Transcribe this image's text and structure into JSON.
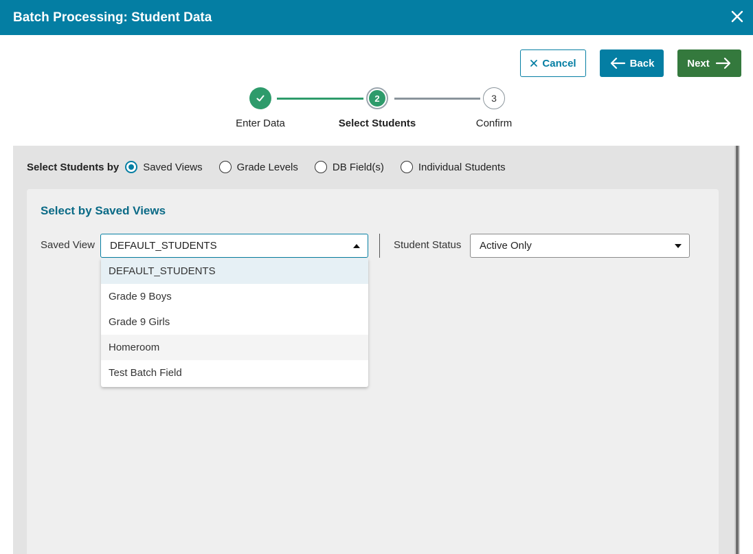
{
  "window": {
    "title": "Batch Processing: Student Data",
    "close_icon": "close-icon"
  },
  "toolbar": {
    "cancel_label": "Cancel",
    "back_label": "Back",
    "next_label": "Next"
  },
  "stepper": {
    "steps": [
      {
        "label": "Enter Data",
        "state": "complete"
      },
      {
        "label": "Select Students",
        "number": "2",
        "state": "current"
      },
      {
        "label": "Confirm",
        "number": "3",
        "state": "pending"
      }
    ]
  },
  "selection": {
    "lead_label": "Select Students by",
    "options": [
      {
        "label": "Saved Views",
        "selected": true
      },
      {
        "label": "Grade Levels",
        "selected": false
      },
      {
        "label": "DB Field(s)",
        "selected": false
      },
      {
        "label": "Individual Students",
        "selected": false
      }
    ]
  },
  "card": {
    "title": "Select by Saved Views",
    "saved_view_label": "Saved View",
    "saved_view_value": "DEFAULT_STUDENTS",
    "student_status_label": "Student Status",
    "student_status_value": "Active Only",
    "dropdown_items": [
      "DEFAULT_STUDENTS",
      "Grade 9 Boys",
      "Grade 9 Girls",
      "Homeroom",
      "Test Batch Field"
    ]
  },
  "colors": {
    "header": "#047ea3",
    "next_button": "#34793d",
    "step_complete": "#2e9b6b",
    "card_title": "#0a6a86"
  }
}
